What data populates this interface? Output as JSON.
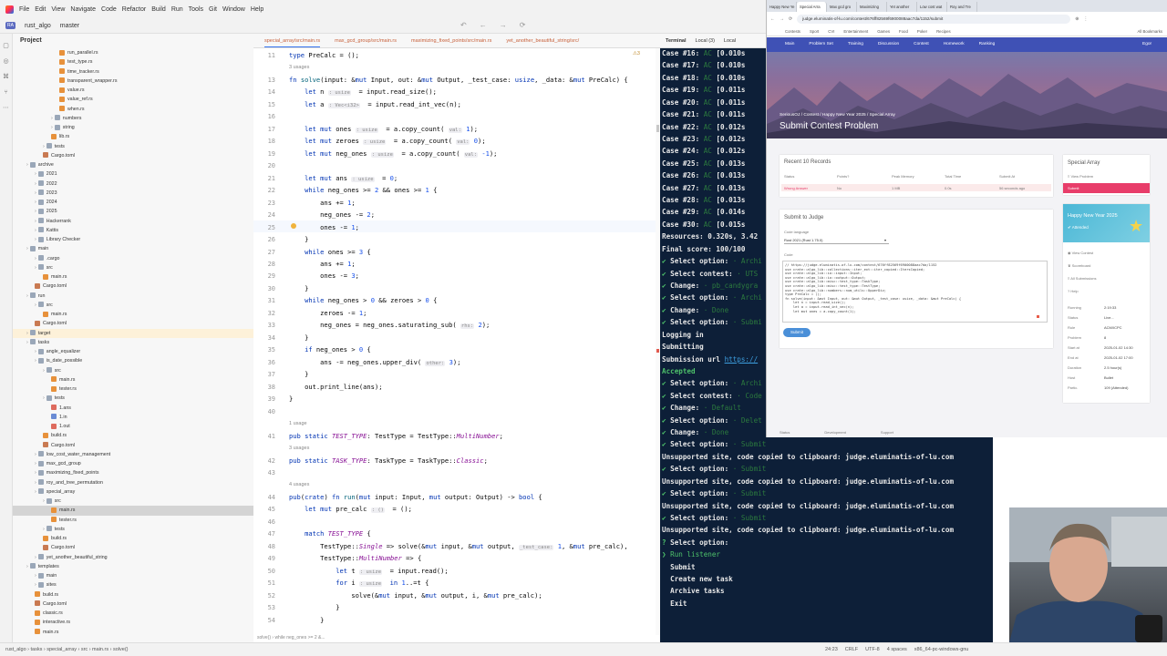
{
  "menu": {
    "items": [
      "File",
      "Edit",
      "View",
      "Navigate",
      "Code",
      "Refactor",
      "Build",
      "Run",
      "Tools",
      "Git",
      "Window",
      "Help"
    ]
  },
  "toolbar": {
    "project_badge": "RA",
    "project": "rust_algo",
    "branch": "master"
  },
  "project_panel": {
    "title": "Project"
  },
  "tree": [
    {
      "label": "run_parallel.rs",
      "indent": 5,
      "icon": "rs"
    },
    {
      "label": "test_type.rs",
      "indent": 5,
      "icon": "rs"
    },
    {
      "label": "time_tracker.rs",
      "indent": 5,
      "icon": "rs"
    },
    {
      "label": "transparent_wrapper.rs",
      "indent": 5,
      "icon": "rs"
    },
    {
      "label": "value.rs",
      "indent": 5,
      "icon": "rs"
    },
    {
      "label": "value_ref.rs",
      "indent": 5,
      "icon": "rs"
    },
    {
      "label": "when.rs",
      "indent": 5,
      "icon": "rs"
    },
    {
      "label": "numbers",
      "indent": 4,
      "icon": "folder"
    },
    {
      "label": "string",
      "indent": 4,
      "icon": "folder"
    },
    {
      "label": "lib.rs",
      "indent": 4,
      "icon": "rs"
    },
    {
      "label": "tests",
      "indent": 3,
      "icon": "folder"
    },
    {
      "label": "Cargo.toml",
      "indent": 3,
      "icon": "toml"
    },
    {
      "label": "archive",
      "indent": 1,
      "icon": "folder"
    },
    {
      "label": "2021",
      "indent": 2,
      "icon": "folder"
    },
    {
      "label": "2022",
      "indent": 2,
      "icon": "folder"
    },
    {
      "label": "2023",
      "indent": 2,
      "icon": "folder"
    },
    {
      "label": "2024",
      "indent": 2,
      "icon": "folder"
    },
    {
      "label": "2025",
      "indent": 2,
      "icon": "folder"
    },
    {
      "label": "Hackerrank",
      "indent": 2,
      "icon": "folder"
    },
    {
      "label": "Kattis",
      "indent": 2,
      "icon": "folder"
    },
    {
      "label": "Library Checker",
      "indent": 2,
      "icon": "folder"
    },
    {
      "label": "main",
      "indent": 1,
      "icon": "folder"
    },
    {
      "label": ".cargo",
      "indent": 2,
      "icon": "folder"
    },
    {
      "label": "src",
      "indent": 2,
      "icon": "folder"
    },
    {
      "label": "main.rs",
      "indent": 3,
      "icon": "rs"
    },
    {
      "label": "Cargo.toml",
      "indent": 2,
      "icon": "toml"
    },
    {
      "label": "run",
      "indent": 1,
      "icon": "folder"
    },
    {
      "label": "src",
      "indent": 2,
      "icon": "folder"
    },
    {
      "label": "main.rs",
      "indent": 3,
      "icon": "rs"
    },
    {
      "label": "Cargo.toml",
      "indent": 2,
      "icon": "toml"
    },
    {
      "label": "target",
      "indent": 1,
      "icon": "folder",
      "state": "hl"
    },
    {
      "label": "tasks",
      "indent": 1,
      "icon": "folder"
    },
    {
      "label": "angle_equalizer",
      "indent": 2,
      "icon": "folder"
    },
    {
      "label": "is_date_possible",
      "indent": 2,
      "icon": "folder"
    },
    {
      "label": "src",
      "indent": 3,
      "icon": "folder"
    },
    {
      "label": "main.rs",
      "indent": 4,
      "icon": "rs"
    },
    {
      "label": "tester.rs",
      "indent": 4,
      "icon": "rs"
    },
    {
      "label": "tests",
      "indent": 3,
      "icon": "folder"
    },
    {
      "label": "1.ans",
      "indent": 4,
      "icon": "red"
    },
    {
      "label": "1.in",
      "indent": 4,
      "icon": "blue"
    },
    {
      "label": "1.out",
      "indent": 4,
      "icon": "red"
    },
    {
      "label": "build.rs",
      "indent": 3,
      "icon": "rs"
    },
    {
      "label": "Cargo.toml",
      "indent": 3,
      "icon": "toml"
    },
    {
      "label": "low_cost_water_management",
      "indent": 2,
      "icon": "folder"
    },
    {
      "label": "max_gcd_group",
      "indent": 2,
      "icon": "folder"
    },
    {
      "label": "maximizing_fixed_points",
      "indent": 2,
      "icon": "folder"
    },
    {
      "label": "roy_and_tree_permutation",
      "indent": 2,
      "icon": "folder"
    },
    {
      "label": "special_array",
      "indent": 2,
      "icon": "folder"
    },
    {
      "label": "src",
      "indent": 3,
      "icon": "folder"
    },
    {
      "label": "main.rs",
      "indent": 4,
      "icon": "rs",
      "state": "sel"
    },
    {
      "label": "tester.rs",
      "indent": 4,
      "icon": "rs"
    },
    {
      "label": "tests",
      "indent": 3,
      "icon": "folder"
    },
    {
      "label": "build.rs",
      "indent": 3,
      "icon": "rs"
    },
    {
      "label": "Cargo.toml",
      "indent": 3,
      "icon": "toml"
    },
    {
      "label": "yet_another_beautiful_string",
      "indent": 2,
      "icon": "folder"
    },
    {
      "label": "templates",
      "indent": 1,
      "icon": "folder"
    },
    {
      "label": "main",
      "indent": 2,
      "icon": "folder"
    },
    {
      "label": "sites",
      "indent": 2,
      "icon": "folder"
    },
    {
      "label": "build.rs",
      "indent": 2,
      "icon": "rs"
    },
    {
      "label": "Cargo.toml",
      "indent": 2,
      "icon": "toml"
    },
    {
      "label": "classic.rs",
      "indent": 2,
      "icon": "rs"
    },
    {
      "label": "interactive.rs",
      "indent": 2,
      "icon": "rs"
    },
    {
      "label": "main.rs",
      "indent": 2,
      "icon": "rs"
    }
  ],
  "editor_tabs": [
    "special_array/src/main.rs",
    "max_gcd_group/src/main.rs",
    "maximizing_fixed_points/src/main.rs",
    "yet_another_beautiful_string/src/"
  ],
  "editor": {
    "warning_count": "⚠3",
    "lines": [
      {
        "n": "11",
        "html": "<span class='kw'>type</span> PreCalc = ();"
      },
      {
        "n": "",
        "usage": "3 usages"
      },
      {
        "n": "13",
        "html": "<span class='kw'>fn</span> <span class='fn'>solve</span>(input: &amp;<span class='kw'>mut</span> Input, out: &amp;<span class='kw'>mut</span> Output, _test_case: <span class='kw'>usize</span>, _data: &amp;<span class='kw'>mut</span> PreCalc) {"
      },
      {
        "n": "14",
        "html": "    <span class='kw'>let</span> n <span class='inlay'>: usize</span>  = input.read_size();"
      },
      {
        "n": "15",
        "html": "    <span class='kw'>let</span> a <span class='inlay'>: Vec&lt;i32&gt;</span>  = input.read_int_vec(n);"
      },
      {
        "n": "16",
        "html": ""
      },
      {
        "n": "17",
        "html": "    <span class='kw'>let mut</span> ones <span class='inlay'>: usize</span>  = a.copy_count( <span class='inlay'>val:</span> <span class='num'>1</span>);"
      },
      {
        "n": "18",
        "html": "    <span class='kw'>let mut</span> zeroes <span class='inlay'>: usize</span>  = a.copy_count( <span class='inlay'>val:</span> <span class='num'>0</span>);"
      },
      {
        "n": "19",
        "html": "    <span class='kw'>let mut</span> neg_ones <span class='inlay'>: usize</span>  = a.copy_count( <span class='inlay'>val:</span> <span class='num'>-1</span>);"
      },
      {
        "n": "20",
        "html": ""
      },
      {
        "n": "21",
        "html": "    <span class='kw'>let mut</span> ans <span class='inlay'>: usize</span>  = <span class='num'>0</span>;"
      },
      {
        "n": "22",
        "html": "    <span class='kw'>while</span> neg_ones &gt;= <span class='num'>2</span> &amp;&amp; ones &gt;= <span class='num'>1</span> {"
      },
      {
        "n": "23",
        "html": "        ans += <span class='num'>1</span>;"
      },
      {
        "n": "24",
        "html": "        neg_ones -= <span class='num'>2</span>;"
      },
      {
        "n": "25",
        "html": "        ones -= <span class='num'>1</span>;"
      },
      {
        "n": "26",
        "html": "    }"
      },
      {
        "n": "27",
        "html": "    <span class='kw'>while</span> ones &gt;= <span class='num'>3</span> {"
      },
      {
        "n": "28",
        "html": "        ans += <span class='num'>1</span>;"
      },
      {
        "n": "29",
        "html": "        ones -= <span class='num'>3</span>;"
      },
      {
        "n": "30",
        "html": "    }"
      },
      {
        "n": "31",
        "html": "    <span class='kw'>while</span> neg_ones &gt; <span class='num'>0</span> &amp;&amp; zeroes &gt; <span class='num'>0</span> {"
      },
      {
        "n": "32",
        "html": "        zeroes -= <span class='num'>1</span>;"
      },
      {
        "n": "33",
        "html": "        neg_ones = neg_ones.saturating_sub( <span class='inlay'>rhs:</span> <span class='num'>2</span>);"
      },
      {
        "n": "34",
        "html": "    }"
      },
      {
        "n": "35",
        "html": "    <span class='kw'>if</span> neg_ones &gt; <span class='num'>0</span> {"
      },
      {
        "n": "36",
        "html": "        ans -= neg_ones.upper_div( <span class='inlay'>other:</span> <span class='num'>3</span>);"
      },
      {
        "n": "37",
        "html": "    }"
      },
      {
        "n": "38",
        "html": "    out.print_line(ans);"
      },
      {
        "n": "39",
        "html": "}"
      },
      {
        "n": "40",
        "html": ""
      },
      {
        "n": "",
        "usage": "1 usage"
      },
      {
        "n": "41",
        "html": "<span class='kw'>pub static</span> <span class='it'>TEST_TYPE</span>: TestType = TestType::<span class='it'>MultiNumber</span>;"
      },
      {
        "n": "",
        "usage": "3 usages"
      },
      {
        "n": "42",
        "html": "<span class='kw'>pub static</span> <span class='it'>TASK_TYPE</span>: TaskType = TaskType::<span class='it'>Classic</span>;"
      },
      {
        "n": "43",
        "html": ""
      },
      {
        "n": "",
        "usage": "4 usages"
      },
      {
        "n": "44",
        "html": "<span class='kw'>pub</span>(<span class='kw'>crate</span>) <span class='kw'>fn</span> <span class='fn'>run</span>(<span class='kw'>mut</span> input: Input, <span class='kw'>mut</span> output: Output) -&gt; <span class='kw'>bool</span> {"
      },
      {
        "n": "45",
        "html": "    <span class='kw'>let mut</span> pre_calc <span class='inlay'>: ()</span>  = ();"
      },
      {
        "n": "46",
        "html": ""
      },
      {
        "n": "47",
        "html": "    <span class='kw'>match</span> <span class='it'>TEST_TYPE</span> {"
      },
      {
        "n": "48",
        "html": "        TestType::<span class='it'>Single</span> =&gt; solve(&amp;<span class='kw'>mut</span> input, &amp;<span class='kw'>mut</span> output, <span class='inlay'>_test_case:</span> <span class='num'>1</span>, &amp;<span class='kw'>mut</span> pre_calc),"
      },
      {
        "n": "49",
        "html": "        TestType::<span class='it'>MultiNumber</span> =&gt; {"
      },
      {
        "n": "50",
        "html": "            <span class='kw'>let</span> t <span class='inlay'>: usize</span>  = input.read();"
      },
      {
        "n": "51",
        "html": "            <span class='kw'>for</span> i <span class='inlay'>: usize</span>  <span class='kw'>in</span> <span class='num'>1</span>..=t {"
      },
      {
        "n": "52",
        "html": "                solve(&amp;<span class='kw'>mut</span> input, &amp;<span class='kw'>mut</span> output, i, &amp;<span class='kw'>mut</span> pre_calc);"
      },
      {
        "n": "53",
        "html": "            }"
      },
      {
        "n": "54",
        "html": "        }"
      }
    ]
  },
  "breadcrumbs": "solve()  ›  while neg_ones >= 2 &...",
  "terminal_tabs": [
    "Terminal",
    "Local (3)",
    "Local"
  ],
  "terminal": {
    "cases": [
      {
        "id": "Case #16:",
        "t": "[0.010s"
      },
      {
        "id": "Case #17:",
        "t": "[0.010s"
      },
      {
        "id": "Case #18:",
        "t": "[0.010s"
      },
      {
        "id": "Case #19:",
        "t": "[0.011s"
      },
      {
        "id": "Case #20:",
        "t": "[0.011s"
      },
      {
        "id": "Case #21:",
        "t": "[0.011s"
      },
      {
        "id": "Case #22:",
        "t": "[0.012s"
      },
      {
        "id": "Case #23:",
        "t": "[0.012s"
      },
      {
        "id": "Case #24:",
        "t": "[0.012s"
      },
      {
        "id": "Case #25:",
        "t": "[0.013s"
      },
      {
        "id": "Case #26:",
        "t": "[0.013s"
      },
      {
        "id": "Case #27:",
        "t": "[0.013s"
      },
      {
        "id": "Case #28:",
        "t": "[0.013s"
      },
      {
        "id": "Case #29:",
        "t": "[0.014s"
      },
      {
        "id": "Case #30:",
        "t": "[0.015s"
      }
    ],
    "verdict": "AC",
    "resources": "Resources: 0.320s, 3.42",
    "score": "Final score: 100/100",
    "log": [
      {
        "k": "✔ Select option:",
        "v": "Archi",
        "type": "opt"
      },
      {
        "k": "✔ Select contest:",
        "v": "UTS",
        "type": "opt"
      },
      {
        "k": "✔ Change:",
        "v": "pb_candygra",
        "type": "opt"
      },
      {
        "k": "✔ Select option:",
        "v": "Archi",
        "type": "opt"
      },
      {
        "k": "✔ Change:",
        "v": "Done",
        "type": "opt"
      },
      {
        "k": "✔ Select option:",
        "v": "Submi",
        "type": "opt"
      },
      {
        "k": "Logging in",
        "v": "",
        "type": "plain"
      },
      {
        "k": "Submitting",
        "v": "",
        "type": "plain"
      },
      {
        "k": "Submission url",
        "v": "https://",
        "type": "link"
      },
      {
        "k": "Accepted",
        "v": "",
        "type": "acc"
      },
      {
        "k": "✔ Select option:",
        "v": "Archi",
        "type": "opt"
      },
      {
        "k": "✔ Select contest:",
        "v": "Code",
        "type": "opt"
      },
      {
        "k": "✔ Change:",
        "v": "Default",
        "type": "opt"
      },
      {
        "k": "✔ Select option:",
        "v": "Delet",
        "type": "opt"
      },
      {
        "k": "✔ Change:",
        "v": "Done",
        "type": "opt"
      },
      {
        "k": "✔ Select option:",
        "v": "Submit",
        "type": "opt"
      },
      {
        "k": "Unsupported site, code copied to clipboard: judge.eluminatis-of-lu.com",
        "v": "",
        "type": "plain"
      },
      {
        "k": "✔ Select option:",
        "v": "Submit",
        "type": "opt"
      },
      {
        "k": "Unsupported site, code copied to clipboard: judge.eluminatis-of-lu.com",
        "v": "",
        "type": "plain"
      },
      {
        "k": "✔ Select option:",
        "v": "Submit",
        "type": "opt"
      },
      {
        "k": "Unsupported site, code copied to clipboard: judge.eluminatis-of-lu.com",
        "v": "",
        "type": "plain"
      },
      {
        "k": "✔ Select option:",
        "v": "Submit",
        "type": "opt"
      },
      {
        "k": "Unsupported site, code copied to clipboard: judge.eluminatis-of-lu.com",
        "v": "",
        "type": "plain"
      },
      {
        "k": "? Select option:",
        "v": "",
        "type": "q"
      }
    ],
    "menu": [
      "❯ Run listener",
      "  Submit",
      "  Create new task",
      "  Archive tasks",
      "  Exit"
    ]
  },
  "status": {
    "path": "rust_algo  ›  tasks  ›  special_array  ›  src  ›  main.rs  ›  solve()",
    "right": [
      "24:23",
      "CRLF",
      "UTF-8",
      "4 spaces",
      "x86_64-pc-windows-gnu"
    ]
  },
  "browser": {
    "tabs": [
      "Happy New Ye",
      "Special Arra",
      "Max gcd gro",
      "Maximizing",
      "Yet another",
      "Low cost wat",
      "Roy and Tre"
    ],
    "url": "judge.eluminatis-of-lu.com/contest/676ff82569f6900088aac7da/1152/submit",
    "bookmarks": [
      "Contests",
      "Sport",
      "CVI",
      "Entertainment",
      "Games",
      "Food",
      "Poker",
      "Recipes"
    ],
    "all_bookmarks": "All Bookmarks",
    "nav": [
      "Main",
      "Problem Set",
      "Training",
      "Discussion",
      "Contest",
      "Homework",
      "Ranking"
    ],
    "user": "Egor",
    "breadcrumb": "SeriousOJ  /  Contest  /  Happy New Year 2025  /  Special Array",
    "title": "Submit Contest Problem",
    "records_title": "Recent 10 Records",
    "records_cols": [
      "Status",
      "Points?",
      "Peak Memory",
      "Total Time",
      "Submit At"
    ],
    "record": [
      "Wrong Answer",
      "No",
      "1 MB",
      "0.0s",
      "56 seconds ago"
    ],
    "judge_title": "Submit to Judge",
    "lang_label": "Code language",
    "lang_value": "Rust 2021 (Rust 1.75.0)",
    "code_label": "Code",
    "code_lines": [
      "// https://judge.eluminatis-of-lu.com/contest/676ff82569f6900088aac7da/1152",
      "use crate::algo_lib::collections::iter_ext::iter_copied::ItersCopied;",
      "use crate::algo_lib::io::input::Input;",
      "use crate::algo_lib::io::output::Output;",
      "use crate::algo_lib::misc::test_type::TaskType;",
      "use crate::algo_lib::misc::test_type::TestType;",
      "use crate::algo_lib::numbers::num_utils::UpperDiv;",
      "type PreCalc = ();",
      "fn solve(input: &mut Input, out: &mut Output, _test_case: usize, _data: &mut PreCalc) {",
      "    let n = input.read_size();",
      "    let a = input.read_int_vec(n);",
      "    let mut ones = a.copy_count(1);"
    ],
    "submit": "Submit",
    "side_title": "Special Array",
    "view_problem": "View Problem",
    "side_submit": "Submit",
    "contest_name": "Happy New Year 2025",
    "attended": "✔ Attended",
    "side_links": [
      "View Contest",
      "Scoreboard",
      "All Submissions",
      "Help"
    ],
    "info": [
      {
        "k": "Running",
        "v": "2:19:33"
      },
      {
        "k": "Status",
        "v": "Live..."
      },
      {
        "k": "Rule",
        "v": "ACM/ICPC"
      },
      {
        "k": "Problem",
        "v": "8"
      },
      {
        "k": "Start at",
        "v": "2025-01-02 14:30"
      },
      {
        "k": "End at",
        "v": "2025-01-02 17:00"
      },
      {
        "k": "Duration",
        "v": "2.5 hour(s)"
      },
      {
        "k": "Host",
        "v": "Bullet"
      },
      {
        "k": "Partic.",
        "v": "109 (Attended)"
      }
    ],
    "footer": [
      "Status",
      "Development",
      "Support"
    ]
  },
  "colors": {
    "accent": "#3574f0",
    "terminal_bg": "#0d1f38",
    "ac_green": "#4ec26a",
    "site_pink": "#e83d6a",
    "site_blue": "#3f51b5"
  }
}
